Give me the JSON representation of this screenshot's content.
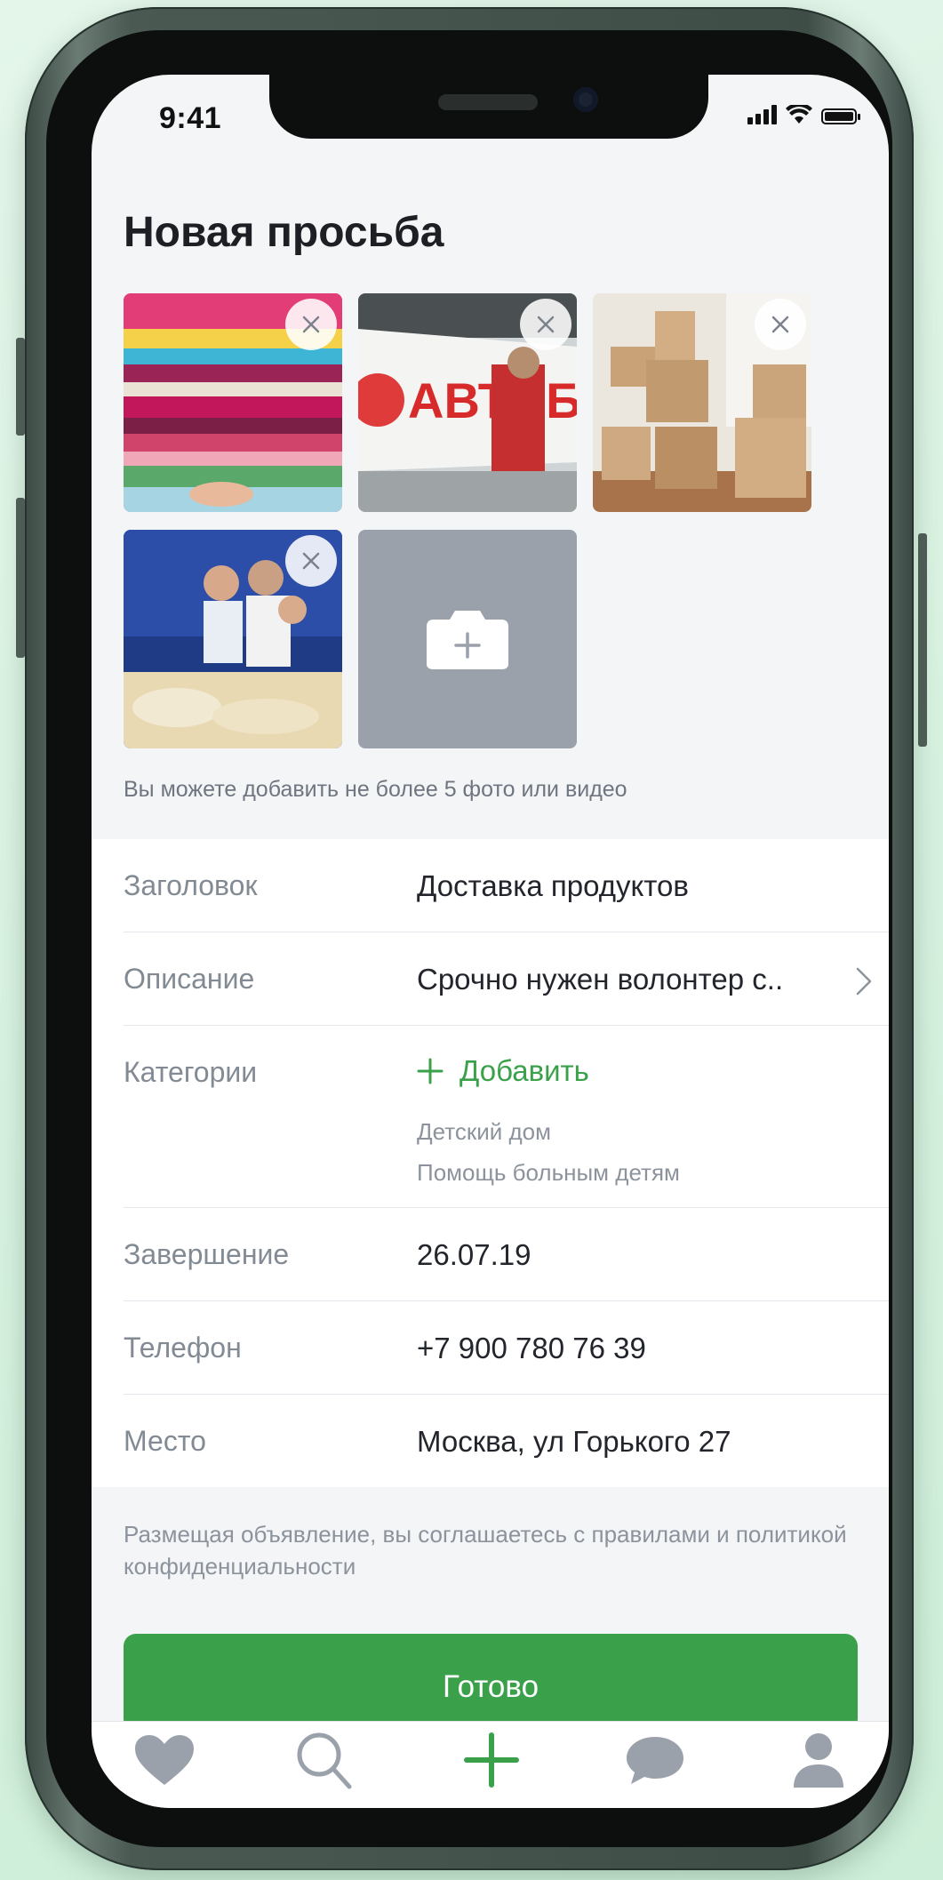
{
  "status_bar": {
    "time": "9:41"
  },
  "page": {
    "title": "Новая просьба"
  },
  "photos": {
    "items": [
      {
        "subject": "stack of folded clothes"
      },
      {
        "subject": "volunteer with bus banner"
      },
      {
        "subject": "cardboard boxes"
      },
      {
        "subject": "volunteers sorting donations"
      }
    ],
    "add_button_icon": "camera-plus-icon",
    "remove_icon": "close-icon",
    "hint": "Вы можете добавить не более 5 фото или видео",
    "bus_banner_text": "АВТОБУС"
  },
  "form": {
    "title_label": "Заголовок",
    "title_value": "Доставка продуктов",
    "description_label": "Описание",
    "description_value": "Срочно нужен волонтер с..",
    "categories_label": "Категории",
    "categories_add": "Добавить",
    "categories": [
      "Детский дом",
      "Помощь больным детям"
    ],
    "end_label": "Завершение",
    "end_value": "26.07.19",
    "phone_label": "Телефон",
    "phone_value": "+7 900 780 76 39",
    "place_label": "Место",
    "place_value": "Москва, ул Горького 27"
  },
  "terms": "Размещая объявление, вы соглашаетесь с правилами и политикой конфиденциальности",
  "done_button": "Готово",
  "tab_bar": {
    "tabs": [
      "heart-icon",
      "search-icon",
      "plus-icon",
      "chat-icon",
      "profile-icon"
    ],
    "active_color": "#3aa14a",
    "inactive_color": "#9aa1ab"
  },
  "colors": {
    "accent": "#3aa14a",
    "background": "#f3f5f7"
  }
}
